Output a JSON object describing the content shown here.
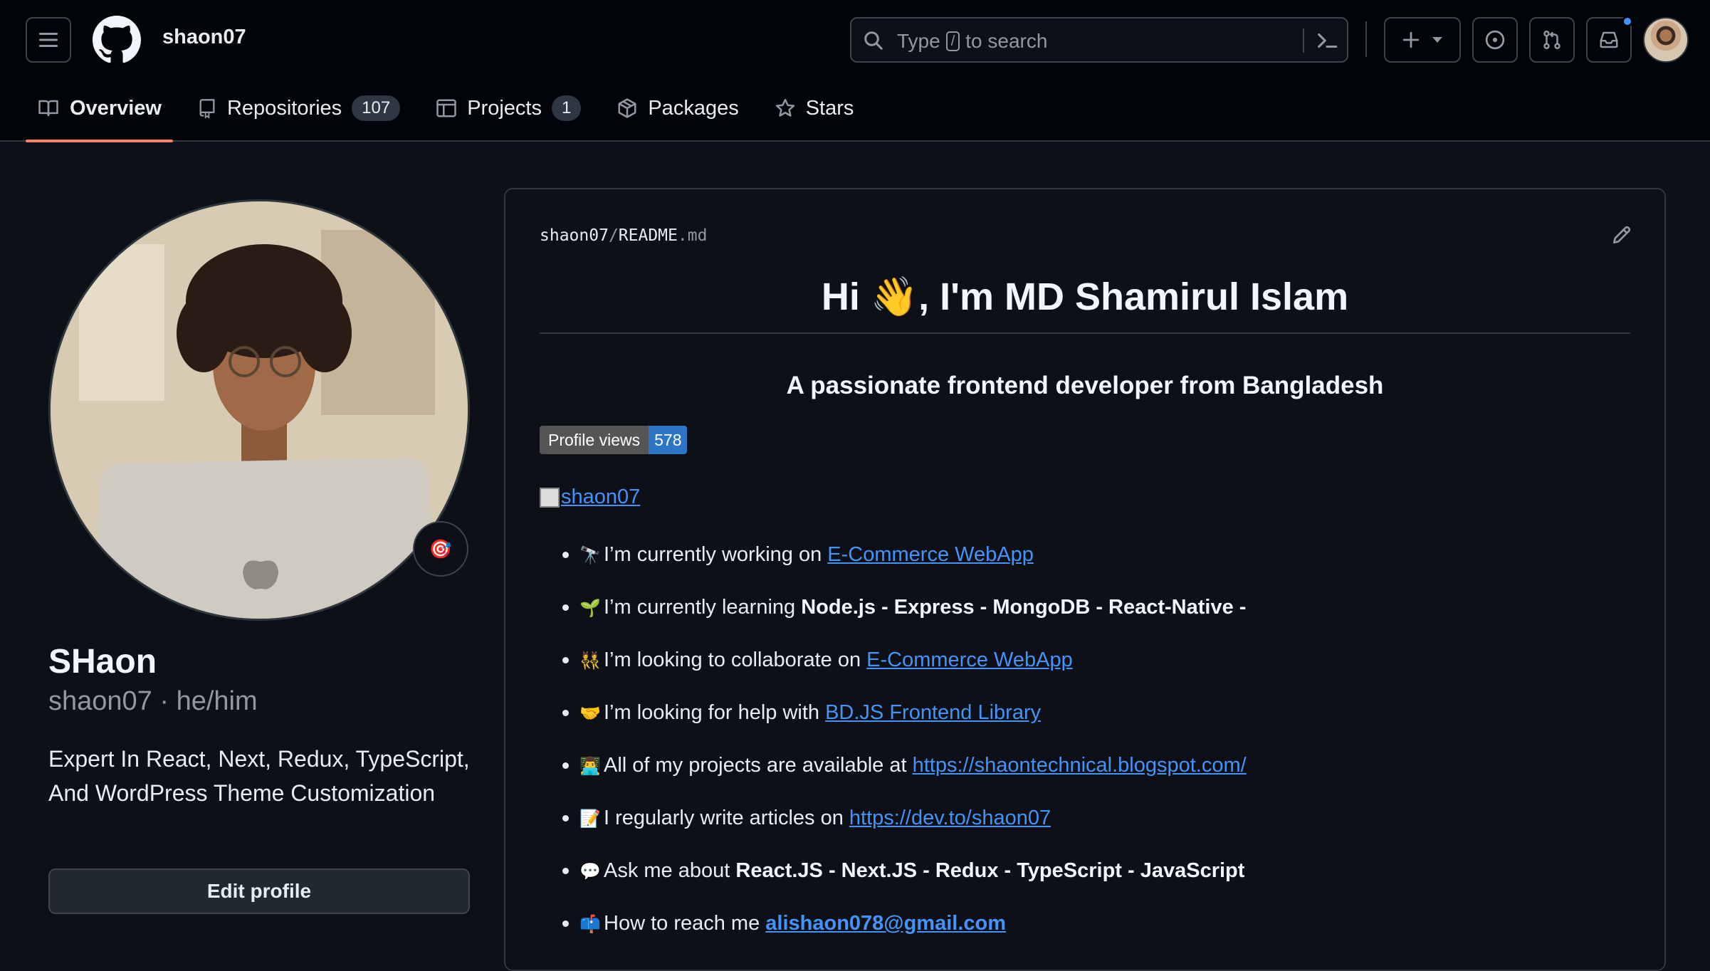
{
  "header": {
    "username": "shaon07",
    "search": {
      "prefix": "Type",
      "key": "/",
      "suffix": "to search"
    }
  },
  "tabs": [
    {
      "label": "Overview",
      "icon": "book-icon"
    },
    {
      "label": "Repositories",
      "count": "107",
      "icon": "repo-icon"
    },
    {
      "label": "Projects",
      "count": "1",
      "icon": "table-icon"
    },
    {
      "label": "Packages",
      "icon": "package-icon"
    },
    {
      "label": "Stars",
      "icon": "star-icon"
    }
  ],
  "profile": {
    "name": "SHaon",
    "login": "shaon07 · he/him",
    "bio": "Expert In React, Next, Redux, TypeScript, And WordPress Theme Customization",
    "edit_label": "Edit profile",
    "status_emoji": "🎯"
  },
  "readme": {
    "path_user": "shaon07",
    "path_sep": "/",
    "path_file": "README",
    "path_ext": ".md",
    "title": "Hi 👋, I'm MD Shamirul Islam",
    "subtitle": "A passionate frontend developer from Bangladesh",
    "badge_label": "Profile views",
    "badge_value": "578",
    "image_alt": "shaon07",
    "items": [
      {
        "emoji": "🔭",
        "text": "I’m currently working on ",
        "link": "E-Commerce WebApp"
      },
      {
        "emoji": "🌱",
        "text": "I’m currently learning ",
        "bold": "Node.js - Express - MongoDB - React-Native -"
      },
      {
        "emoji": "👯",
        "text": "I’m looking to collaborate on ",
        "link": "E-Commerce WebApp"
      },
      {
        "emoji": "🤝",
        "text": "I’m looking for help with ",
        "link": "BD.JS Frontend Library"
      },
      {
        "emoji": "👨‍💻",
        "text": "All of my projects are available at ",
        "link": "https://shaontechnical.blogspot.com/"
      },
      {
        "emoji": "📝",
        "text": "I regularly write articles on ",
        "link": "https://dev.to/shaon07"
      },
      {
        "emoji": "💬",
        "text": "Ask me about ",
        "bold": "React.JS - Next.JS - Redux - TypeScript - JavaScript"
      },
      {
        "emoji": "📫",
        "text": "How to reach me ",
        "link": "alishaon078@gmail.com",
        "link_bold": true
      }
    ]
  },
  "colors": {
    "accent": "#f78166",
    "link": "#4493f8",
    "bg": "#0d1117"
  }
}
